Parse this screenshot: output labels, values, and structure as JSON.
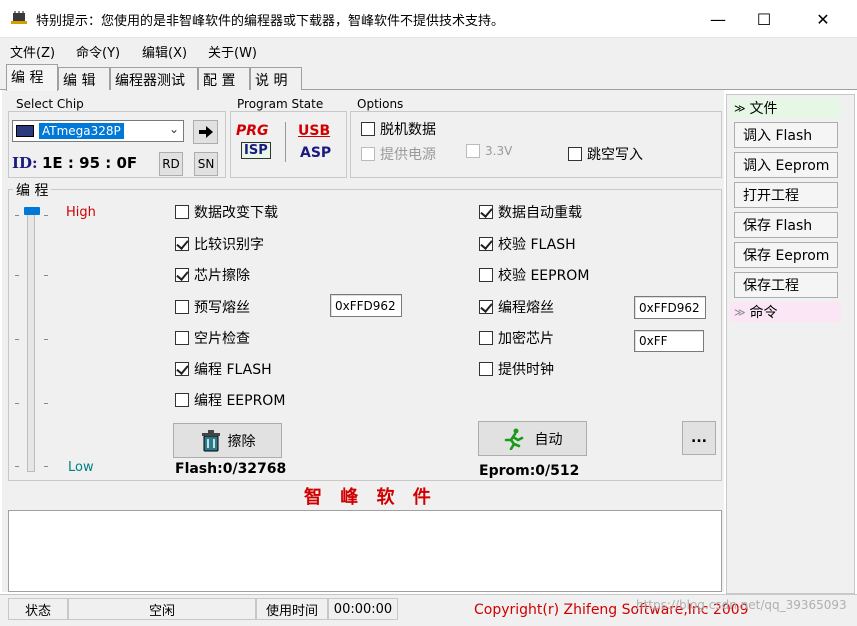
{
  "window": {
    "title": "特别提示：您使用的是非智峰软件的编程器或下载器，智峰软件不提供技术支持。",
    "min": "—",
    "max": "☐",
    "close": "✕"
  },
  "menu": [
    "文件(Z)",
    "命令(Y)",
    "编辑(X)",
    "关于(W)"
  ],
  "tabs": [
    "编 程",
    "编 辑",
    "编程器测试",
    "配 置",
    "说 明"
  ],
  "select_chip": {
    "title": "Select Chip",
    "value": "ATmega328P",
    "go_icon": "arrow-right-icon",
    "id_label": "ID:",
    "id_value": "1E : 95 : 0F",
    "rd_label": "RD",
    "sn_label": "SN"
  },
  "program_state": {
    "title": "Program State",
    "prg": "PRG",
    "isp": "ISP",
    "usb": "USB",
    "asp": "ASP"
  },
  "options": {
    "title": "Options",
    "offline": {
      "label": "脱机数据",
      "checked": false
    },
    "power": {
      "label": "提供电源",
      "checked": false,
      "disabled": true
    },
    "v33": {
      "label": "3.3V",
      "checked": false,
      "disabled": true
    },
    "skip_empty": {
      "label": "跳空写入",
      "checked": false
    }
  },
  "program": {
    "title": "编 程",
    "high": "High",
    "low": "Low",
    "left_opts": [
      {
        "label": "数据改变下载",
        "checked": false
      },
      {
        "label": "比较识别字",
        "checked": true
      },
      {
        "label": "芯片擦除",
        "checked": true
      },
      {
        "label": "预写熔丝",
        "checked": false
      },
      {
        "label": "空片检查",
        "checked": false
      },
      {
        "label": "编程 FLASH",
        "checked": true
      },
      {
        "label": "编程 EEPROM",
        "checked": false
      }
    ],
    "right_opts": [
      {
        "label": "数据自动重载",
        "checked": true
      },
      {
        "label": "校验 FLASH",
        "checked": true
      },
      {
        "label": "校验 EEPROM",
        "checked": false
      },
      {
        "label": "编程熔丝",
        "checked": true
      },
      {
        "label": "加密芯片",
        "checked": false
      },
      {
        "label": "提供时钟",
        "checked": false
      }
    ],
    "prefuse_value": "0xFFD962",
    "fuse_value": "0xFFD962",
    "lock_value": "0xFF",
    "erase_label": "擦除",
    "auto_label": "自动",
    "more_label": "...",
    "flash_info": "Flash:0/32768",
    "eprom_info": "Eprom:0/512",
    "brand": "智 峰 软 件",
    "slider_level": 1.0
  },
  "side": {
    "file_head": "文件",
    "file_buttons": [
      "调入 Flash",
      "调入 Eeprom",
      "打开工程",
      "保存 Flash",
      "保存 Eeprom",
      "保存工程"
    ],
    "cmd_head": "命令"
  },
  "status": {
    "state_label": "状态",
    "state_value": "空闲",
    "time_label": "使用时间",
    "time_value": "00:00:00",
    "copyright": "Copyright(r) Zhifeng Software,Inc 2009",
    "watermark": "https://blog.csdn.net/qq_39365093"
  },
  "colors": {
    "accent": "#0078d7",
    "red": "#d00000",
    "teal": "#008080",
    "file_head_bg": "#e6f7e6",
    "cmd_head_bg": "#fbe6f5"
  }
}
